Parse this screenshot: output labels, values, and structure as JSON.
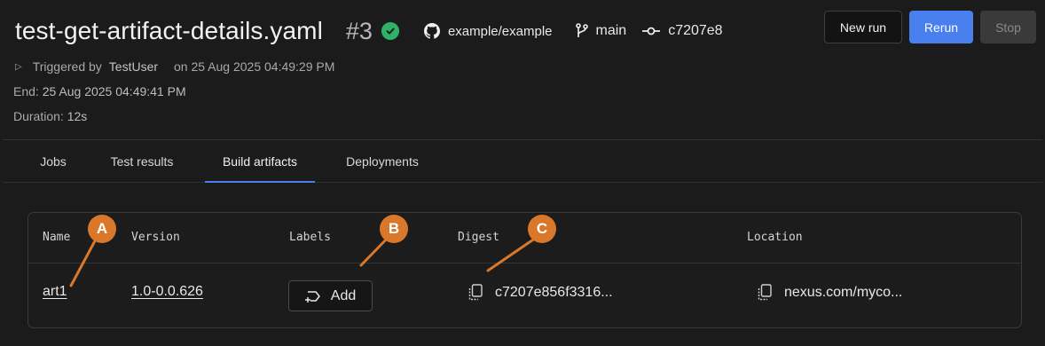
{
  "header": {
    "title": "test-get-artifact-details.yaml",
    "run_number": "#3",
    "repo": "example/example",
    "branch": "main",
    "commit": "c7207e8",
    "triggered_by_label": "Triggered by",
    "triggered_by_user": "TestUser",
    "triggered_on": "on 25 Aug 2025 04:49:29 PM",
    "end_label": "End:",
    "end_value": "25 Aug 2025 04:49:41 PM",
    "duration_label": "Duration:",
    "duration_value": "12s"
  },
  "buttons": {
    "new_run": "New run",
    "rerun": "Rerun",
    "stop": "Stop"
  },
  "tabs": [
    {
      "label": "Jobs"
    },
    {
      "label": "Test results"
    },
    {
      "label": "Build artifacts",
      "active": true
    },
    {
      "label": "Deployments"
    }
  ],
  "table": {
    "columns": [
      "Name",
      "Version",
      "Labels",
      "Digest",
      "Location"
    ],
    "rows": [
      {
        "name": "art1",
        "version": "1.0-0.0.626",
        "labels_button": "Add",
        "digest": "c7207e856f3316...",
        "location": "nexus.com/myco..."
      }
    ]
  },
  "markers": [
    "A",
    "B",
    "C"
  ],
  "colors": {
    "accent": "#4a7ff0",
    "success": "#2fb268",
    "marker": "#d9782a"
  },
  "icons": {
    "status": "check-circle-icon",
    "repo": "github-icon",
    "branch": "git-branch-icon",
    "commit": "git-commit-icon",
    "add_label": "label-add-icon",
    "copy": "copy-icon"
  }
}
